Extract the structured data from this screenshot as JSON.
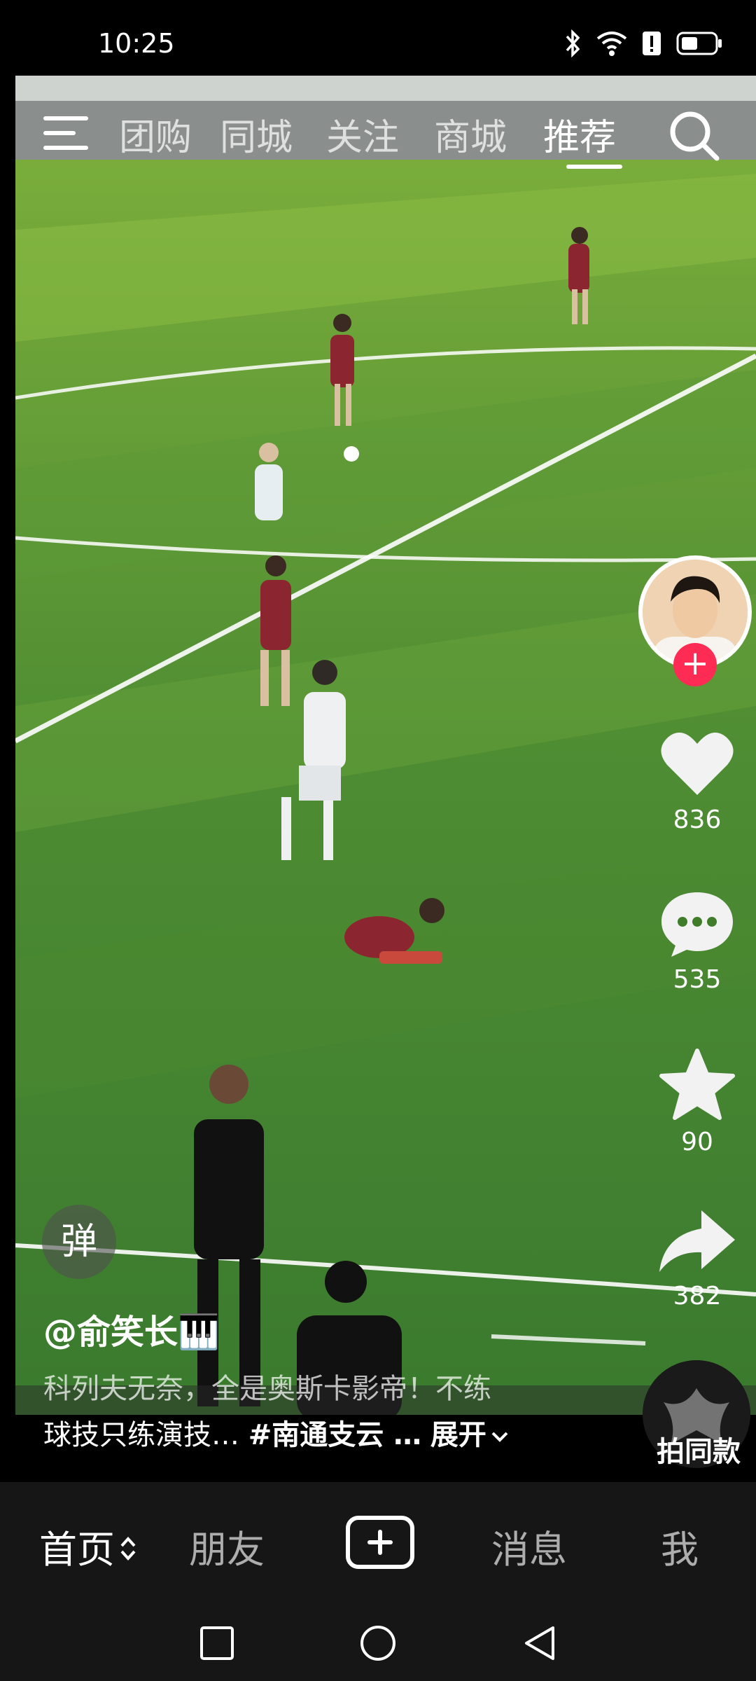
{
  "status_bar": {
    "time": "10:25",
    "icons": [
      "bluetooth-icon",
      "wifi-icon",
      "alert-icon",
      "battery-icon"
    ]
  },
  "top_tabs": {
    "items": [
      "团购",
      "同城",
      "关注",
      "商城",
      "推荐"
    ],
    "active": "推荐"
  },
  "rail": {
    "likes": "836",
    "comments": "535",
    "favorites": "90",
    "shares": "382"
  },
  "danmaku": {
    "label": "弹"
  },
  "caption": {
    "author": "@俞笑长🎹",
    "line1": "科列夫无奈，全是奥斯卡影帝！不练",
    "line2_prefix": "球技只练演技… ",
    "hashtag": "#南通支云 …",
    "expand": "展开"
  },
  "same_style": {
    "label": "拍同款"
  },
  "bottom_nav": {
    "home": "首页",
    "friends": "朋友",
    "messages": "消息",
    "me": "我"
  },
  "colors": {
    "accent": "#fe2c55",
    "background": "#000000",
    "navbar": "#161616"
  }
}
